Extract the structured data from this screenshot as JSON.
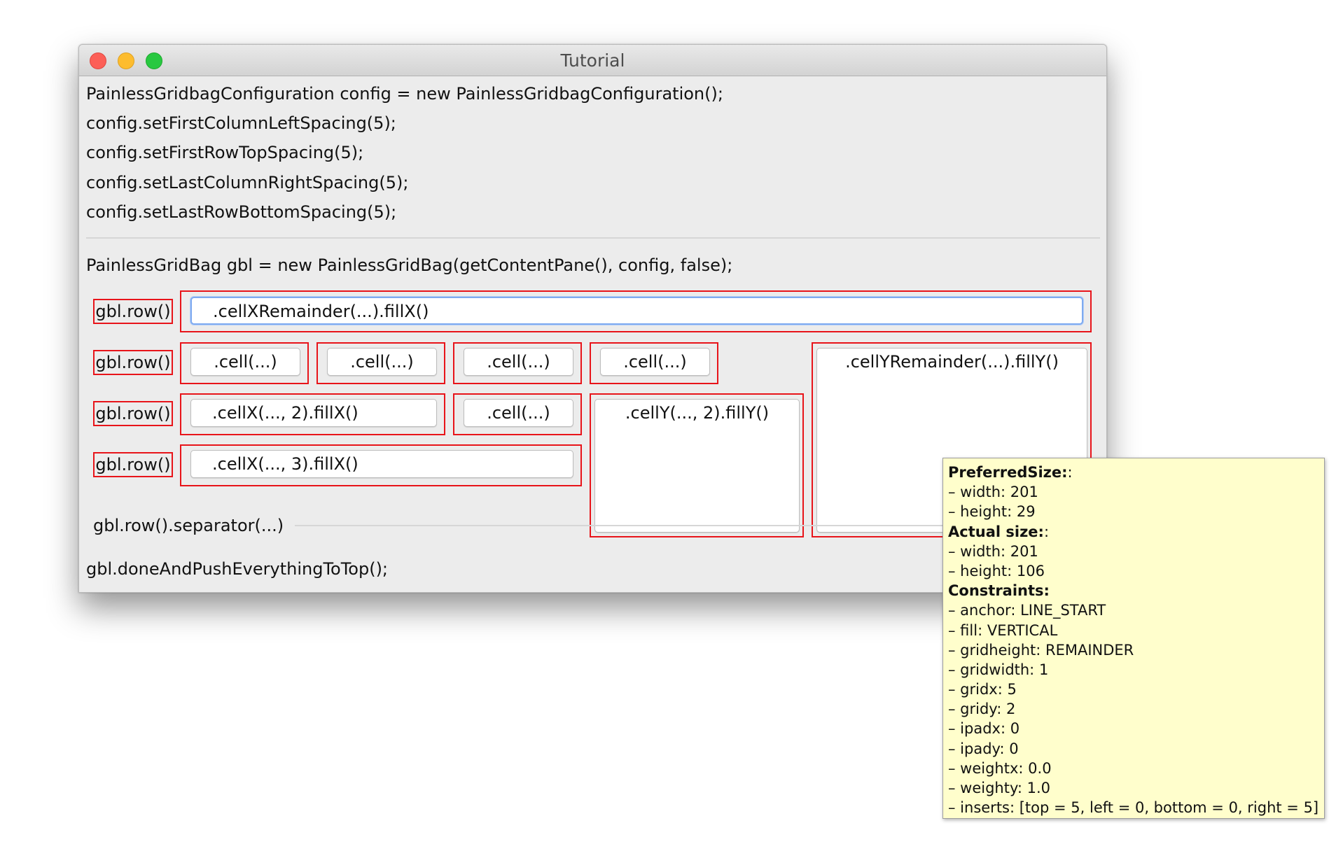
{
  "window": {
    "title": "Tutorial"
  },
  "code": {
    "line1": "PainlessGridbagConfiguration config = new PainlessGridbagConfiguration();",
    "line2": "config.setFirstColumnLeftSpacing(5);",
    "line3": "config.setFirstRowTopSpacing(5);",
    "line4": "config.setLastColumnRightSpacing(5);",
    "line5": "config.setLastRowBottomSpacing(5);",
    "line6": "PainlessGridBag gbl = new PainlessGridBag(getContentPane(), config, false);",
    "separator_label": "gbl.row().separator(...)",
    "done": "gbl.doneAndPushEverythingToTop();"
  },
  "grid": {
    "row_label": "gbl.row()",
    "r1c1": ".cellXRemainder(...).fillX()",
    "r2c1": ".cell(...)",
    "r2c2": ".cell(...)",
    "r2c3": ".cell(...)",
    "r2c4": ".cell(...)",
    "r2c5": ".cellYRemainder(...).fillY()",
    "r3c1": ".cellX(..., 2).fillX()",
    "r3c2": ".cell(...)",
    "r3c3": ".cellY(..., 2).fillY()",
    "r4c1": ".cellX(..., 3).fillX()"
  },
  "tooltip": {
    "preferred_heading": "PreferredSize:",
    "preferred_heading_suffix": ":",
    "pref_width": "– width: 201",
    "pref_height": "– height: 29",
    "actual_heading": "Actual size:",
    "actual_heading_suffix": ":",
    "act_width": "– width: 201",
    "act_height": "– height: 106",
    "constraints_heading": "Constraints:",
    "anchor": "– anchor: LINE_START",
    "fill": "– fill: VERTICAL",
    "gridheight": "– gridheight: REMAINDER",
    "gridwidth": "– gridwidth: 1",
    "gridx": "– gridx: 5",
    "gridy": "– gridy: 2",
    "ipadx": "– ipadx: 0",
    "ipady": "– ipady: 0",
    "weightx": "– weightx: 0.0",
    "weighty": "– weighty: 1.0",
    "inserts": "– inserts: [top = 5, left = 0, bottom = 0, right = 5]"
  },
  "colors": {
    "highlight_border": "#e8141a",
    "tooltip_background": "#fffecc",
    "focus_border": "#7eaaf0"
  }
}
